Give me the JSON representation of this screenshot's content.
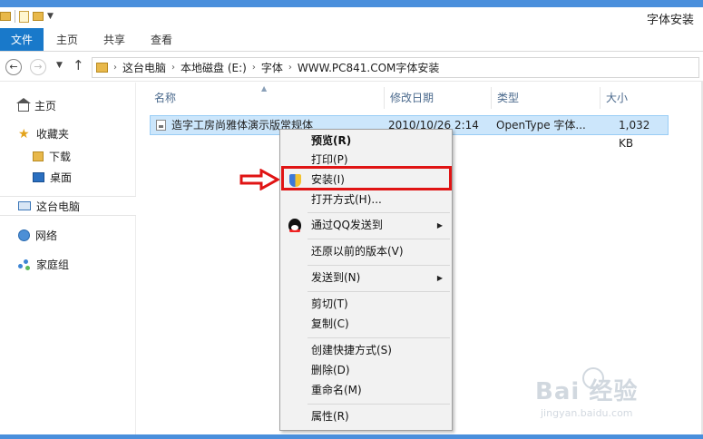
{
  "window": {
    "title": "字体安装"
  },
  "ribbon": {
    "tabs": [
      "文件",
      "主页",
      "共享",
      "查看"
    ]
  },
  "address": {
    "crumbs": [
      "这台电脑",
      "本地磁盘 (E:)",
      "字体",
      "WWW.PC841.COM字体安装"
    ]
  },
  "sidebar": {
    "items": [
      "主页",
      "收藏夹",
      "下载",
      "桌面",
      "这台电脑",
      "网络",
      "家庭组"
    ]
  },
  "columns": {
    "name": "名称",
    "modified": "修改日期",
    "type": "类型",
    "size": "大小"
  },
  "file": {
    "name": "造字工房尚雅体演示版常规体",
    "modified": "2010/10/26 2:14",
    "type": "OpenType 字体...",
    "size": "1,032 KB"
  },
  "context_menu": {
    "preview": "预览(R)",
    "print": "打印(P)",
    "install": "安装(I)",
    "open_with": "打开方式(H)...",
    "send_qq": "通过QQ发送到",
    "restore": "还原以前的版本(V)",
    "send_to": "发送到(N)",
    "cut": "剪切(T)",
    "copy": "复制(C)",
    "shortcut": "创建快捷方式(S)",
    "delete": "删除(D)",
    "rename": "重命名(M)",
    "properties": "属性(R)"
  },
  "annotation": {
    "highlight_color": "#e01414"
  },
  "watermark": {
    "main": "Bai 经验",
    "sub": "jingyan.baidu.com"
  }
}
